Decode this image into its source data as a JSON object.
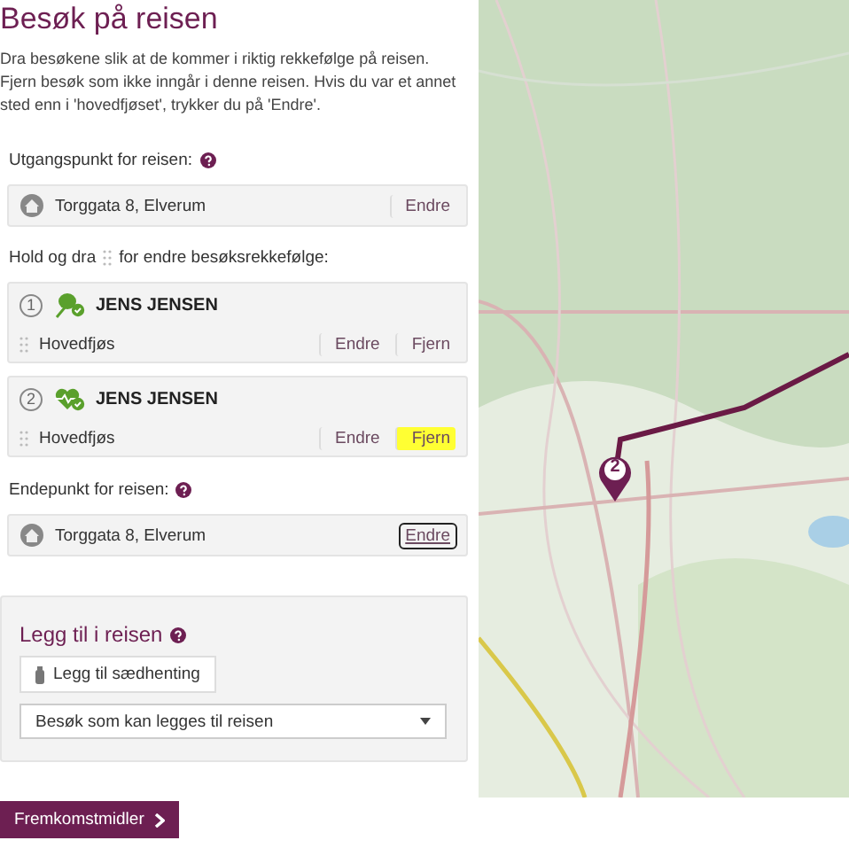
{
  "title": "Besøk på reisen",
  "intro": "Dra besøkene slik at de kommer i riktig rekkefølge på reisen. Fjern besøk som ikke inngår i denne reisen. Hvis du var et annet sted enn i 'hovedfjøset', trykker du på 'Endre'.",
  "start": {
    "label": "Utgangspunkt for reisen:",
    "address": "Torggata 8, Elverum",
    "action": {
      "label": "Endre",
      "focused": false
    }
  },
  "drag_hint": {
    "before": "Hold og dra",
    "after": "for endre besøksrekkefølge:"
  },
  "visits": [
    {
      "number": "1",
      "kind": "plant",
      "name": "JENS JENSEN",
      "location": "Hovedfjøs",
      "actions": [
        {
          "label": "Endre",
          "highlighted": false
        },
        {
          "label": "Fjern",
          "highlighted": false
        }
      ]
    },
    {
      "number": "2",
      "kind": "heart",
      "name": "JENS JENSEN",
      "location": "Hovedfjøs",
      "actions": [
        {
          "label": "Endre",
          "highlighted": false
        },
        {
          "label": "Fjern",
          "highlighted": true
        }
      ]
    }
  ],
  "end": {
    "label": "Endepunkt for reisen:",
    "address": "Torggata 8, Elverum",
    "action": {
      "label": "Endre",
      "focused": true
    }
  },
  "add": {
    "title": "Legg til i reisen",
    "button": "Legg til sædhenting",
    "select": "Besøk som kan legges til reisen"
  },
  "next_button": "Fremkomstmidler",
  "map": {
    "kind": "picture",
    "marker": "2"
  }
}
